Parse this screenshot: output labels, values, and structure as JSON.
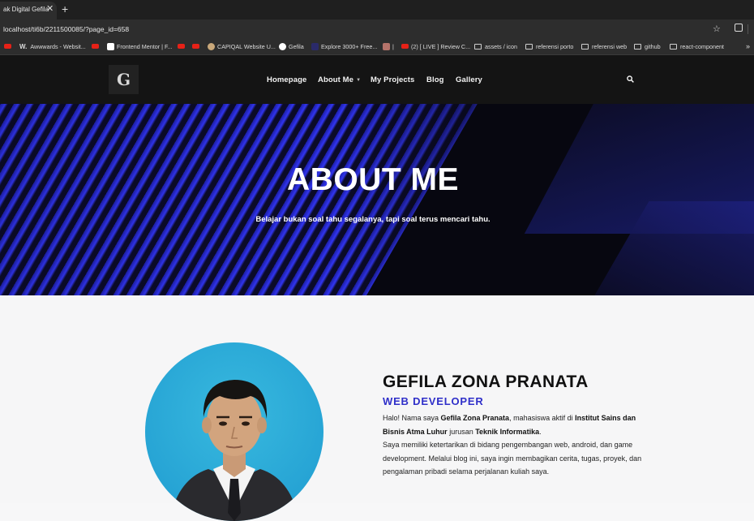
{
  "browser": {
    "tab_title": "ak Digital Gefila",
    "url": "localhost/ti6b/2211500085/?page_id=658",
    "bookmarks": [
      {
        "label": "",
        "icon": "youtube-icon"
      },
      {
        "label": "Awwwards - Websit...",
        "icon": "awwwards-icon"
      },
      {
        "label": "",
        "icon": "youtube-icon"
      },
      {
        "label": "Frontend Mentor | F...",
        "icon": "frontend-mentor-icon"
      },
      {
        "label": "",
        "icon": "youtube-icon"
      },
      {
        "label": "",
        "icon": "youtube-icon"
      },
      {
        "label": "CAPIQAL Website U...",
        "icon": "capiqal-icon"
      },
      {
        "label": "Gefila",
        "icon": "github-icon"
      },
      {
        "label": "Explore 3000+ Free...",
        "icon": "ui-icon"
      },
      {
        "label": "|",
        "icon": "app-icon"
      },
      {
        "label": "(2) [ LIVE ] Review C...",
        "icon": "youtube-icon"
      },
      {
        "label": "assets / icon",
        "icon": "folder-icon"
      },
      {
        "label": "referensi porto",
        "icon": "folder-icon"
      },
      {
        "label": "referensi web",
        "icon": "folder-icon"
      },
      {
        "label": "github",
        "icon": "folder-icon"
      },
      {
        "label": "react-component",
        "icon": "folder-icon"
      }
    ]
  },
  "nav": {
    "logo_text": "G",
    "links": [
      "Homepage",
      "About Me",
      "My Projects",
      "Blog",
      "Gallery"
    ]
  },
  "hero": {
    "title": "ABOUT ME",
    "subtitle": "Belajar bukan soal tahu segalanya, tapi soal terus mencari tahu."
  },
  "about": {
    "name": "GEFILA ZONA PRANATA",
    "role": "WEB DEVELOPER",
    "bio_p1_a": "Halo! Nama saya ",
    "bio_p1_name": "Gefila Zona Pranata",
    "bio_p1_b": ", mahasiswa aktif di ",
    "bio_p1_school": "Institut Sains dan Bisnis Atma Luhur",
    "bio_p1_c": " jurusan ",
    "bio_p1_major": "Teknik Informatika",
    "bio_p1_d": ".",
    "bio_p2": "Saya memiliki ketertarikan di bidang pengembangan web, android, dan game development. Melalui blog ini, saya ingin membagikan cerita, tugas, proyek, dan pengalaman pribadi selama perjalanan kuliah saya."
  },
  "colors": {
    "accent_blue": "#2f2fc9",
    "nav_bg": "#141414",
    "hero_stripe": "#3438ff"
  }
}
